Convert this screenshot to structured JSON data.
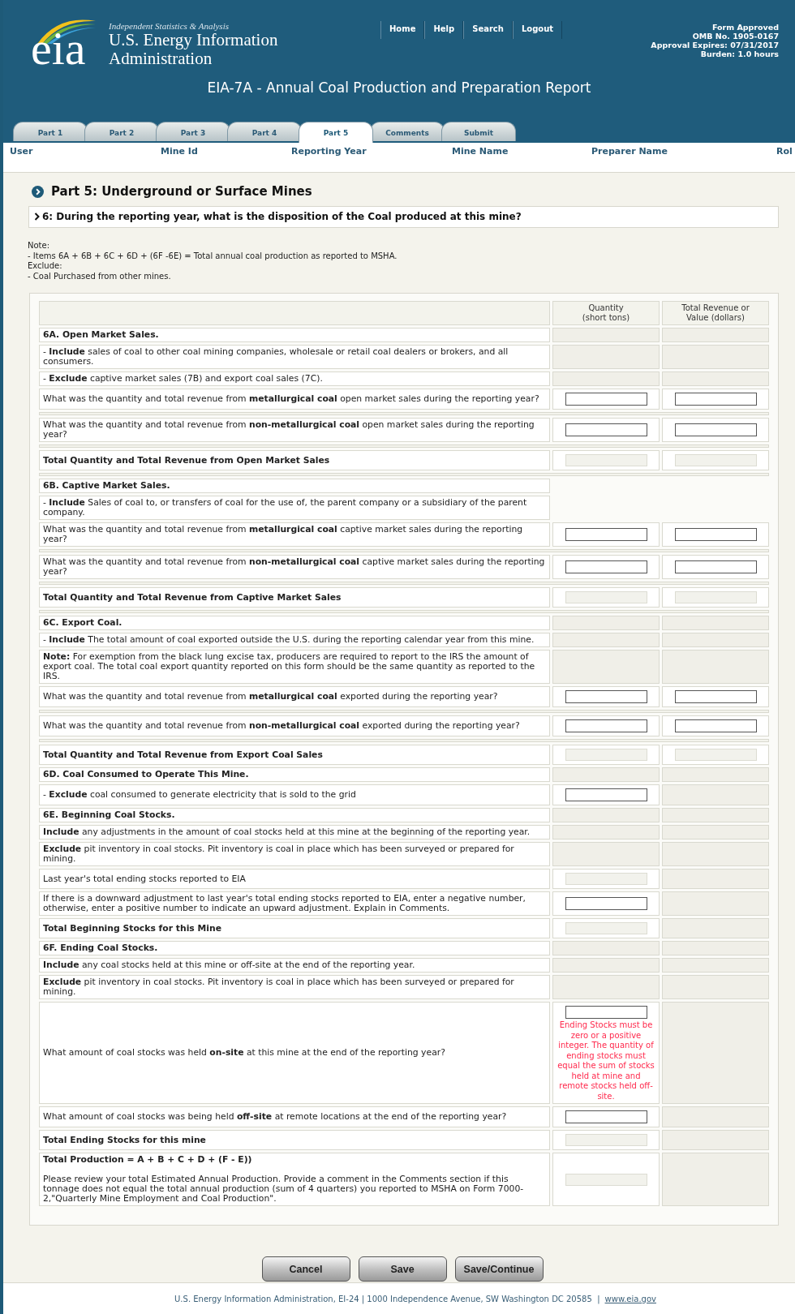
{
  "header": {
    "tagline": "Independent Statistics & Analysis",
    "agency_lines": [
      "U.S. Energy Information",
      "Administration"
    ],
    "logo_text": "eia",
    "nav": [
      "Home",
      "Help",
      "Search",
      "Logout"
    ],
    "approval": [
      "Form Approved",
      "OMB No. 1905-0167",
      "Approval Expires: 07/31/2017",
      "Burden: 1.0 hours"
    ],
    "title": "EIA-7A - Annual Coal Production and Preparation Report"
  },
  "tabs": [
    {
      "label": "Part 1",
      "selected": false
    },
    {
      "label": "Part 2",
      "selected": false
    },
    {
      "label": "Part 3",
      "selected": false
    },
    {
      "label": "Part 4",
      "selected": false
    },
    {
      "label": "Part 5",
      "selected": true
    },
    {
      "label": "Comments",
      "selected": false
    },
    {
      "label": "Submit",
      "selected": false
    }
  ],
  "info_fields": [
    "User",
    "Mine Id",
    "Reporting Year",
    "Mine Name",
    "Preparer Name",
    "Rol"
  ],
  "part_heading": "Part 5: Underground or Surface Mines",
  "question": "6: During the reporting year, what is the disposition of the Coal produced at this mine?",
  "note_lines": [
    "Note:",
    "- Items 6A + 6B + 6C + 6D + (6F -6E) = Total annual coal production as reported to MSHA.",
    "Exclude:",
    "- Coal Purchased from other mines."
  ],
  "columns": [
    {
      "lines": [
        "Quantity",
        "(short tons)"
      ]
    },
    {
      "lines": [
        "Total Revenue or",
        "Value (dollars)"
      ]
    }
  ],
  "rows": [
    {
      "kind": "heading",
      "label": "6A. Open Market Sales.",
      "cells": [
        {
          "kind": "blank"
        },
        {
          "kind": "blank"
        }
      ]
    },
    {
      "kind": "text",
      "label": "- **Include** sales of coal to other coal mining companies, wholesale or retail coal dealers or brokers, and all consumers.",
      "cells": [
        {
          "kind": "blank"
        },
        {
          "kind": "blank"
        }
      ]
    },
    {
      "kind": "text",
      "label": "- **Exclude** captive market sales (7B) and export coal sales (7C).",
      "cells": [
        {
          "kind": "blank"
        },
        {
          "kind": "blank"
        }
      ]
    },
    {
      "kind": "text",
      "label": "What was the quantity and total revenue from **metallurgical coal** open market sales during the reporting year?",
      "cells": [
        {
          "kind": "input"
        },
        {
          "kind": "input"
        }
      ]
    },
    {
      "kind": "gap"
    },
    {
      "kind": "text",
      "label": "What was the quantity and total revenue from **non-metallurgical coal** open market sales during the reporting year?",
      "cells": [
        {
          "kind": "input"
        },
        {
          "kind": "input"
        }
      ]
    },
    {
      "kind": "gap"
    },
    {
      "kind": "heading",
      "label": "Total Quantity and Total Revenue from Open Market Sales",
      "cells": [
        {
          "kind": "readonly"
        },
        {
          "kind": "readonly"
        }
      ]
    },
    {
      "kind": "gap"
    },
    {
      "kind": "heading",
      "label": "6B. Captive Market Sales.",
      "cells": [
        {
          "kind": "none"
        },
        {
          "kind": "none"
        }
      ]
    },
    {
      "kind": "text",
      "label": "- **Include** Sales of coal to, or transfers of coal for the use of, the parent company or a subsidiary of the parent company.",
      "cells": [
        {
          "kind": "none"
        },
        {
          "kind": "none"
        }
      ]
    },
    {
      "kind": "text",
      "label": "What was the quantity and total revenue from **metallurgical coal** captive market sales during the reporting year?",
      "cells": [
        {
          "kind": "input"
        },
        {
          "kind": "input"
        }
      ]
    },
    {
      "kind": "gap"
    },
    {
      "kind": "text",
      "label": "What was the quantity and total revenue from **non-metallurgical coal** captive market sales during the reporting year?",
      "cells": [
        {
          "kind": "input"
        },
        {
          "kind": "input"
        }
      ]
    },
    {
      "kind": "gap"
    },
    {
      "kind": "heading",
      "label": "Total Quantity and Total Revenue from Captive Market Sales",
      "cells": [
        {
          "kind": "readonly"
        },
        {
          "kind": "readonly"
        }
      ]
    },
    {
      "kind": "gap"
    },
    {
      "kind": "heading",
      "label": "6C. Export Coal.",
      "cells": [
        {
          "kind": "blank"
        },
        {
          "kind": "blank"
        }
      ]
    },
    {
      "kind": "text",
      "label": "- **Include**  The total amount of coal exported outside the U.S. during the reporting calendar year from this mine.",
      "cells": [
        {
          "kind": "blank"
        },
        {
          "kind": "blank"
        }
      ]
    },
    {
      "kind": "text",
      "label": "**Note:** For exemption from the black lung excise tax, producers are required to report to the IRS the amount of export coal. The total coal export quantity reported on this form should be the same quantity as reported to the IRS.",
      "cells": [
        {
          "kind": "blank"
        },
        {
          "kind": "blank"
        }
      ]
    },
    {
      "kind": "text",
      "label": "What was the quantity and total revenue from **metallurgical coal** exported during the reporting year?",
      "cells": [
        {
          "kind": "input"
        },
        {
          "kind": "input"
        }
      ]
    },
    {
      "kind": "gap"
    },
    {
      "kind": "text",
      "label": "What was the quantity and total revenue from **non-metallurgical coal** exported during the reporting year?",
      "cells": [
        {
          "kind": "input"
        },
        {
          "kind": "input"
        }
      ]
    },
    {
      "kind": "gap"
    },
    {
      "kind": "heading",
      "label": "Total Quantity and Total Revenue from Export Coal Sales",
      "cells": [
        {
          "kind": "readonly"
        },
        {
          "kind": "readonly"
        }
      ]
    },
    {
      "kind": "heading",
      "label": "6D. Coal Consumed to Operate This Mine.",
      "cells": [
        {
          "kind": "blank"
        },
        {
          "kind": "blank"
        }
      ]
    },
    {
      "kind": "text",
      "label": "- **Exclude** coal consumed to generate electricity that is sold to the grid",
      "cells": [
        {
          "kind": "input"
        },
        {
          "kind": "blank"
        }
      ]
    },
    {
      "kind": "heading",
      "label": "6E. Beginning Coal Stocks.",
      "cells": [
        {
          "kind": "blank"
        },
        {
          "kind": "blank"
        }
      ]
    },
    {
      "kind": "text",
      "label": "**Include** any adjustments in the amount of coal stocks held at this mine at the beginning of the reporting year.",
      "cells": [
        {
          "kind": "blank"
        },
        {
          "kind": "blank"
        }
      ]
    },
    {
      "kind": "text",
      "label": "**Exclude** pit inventory in coal stocks. Pit inventory is coal in place which has been surveyed or prepared for mining.",
      "cells": [
        {
          "kind": "blank"
        },
        {
          "kind": "blank"
        }
      ]
    },
    {
      "kind": "text",
      "label": "Last year's total ending stocks reported to EIA",
      "cells": [
        {
          "kind": "readonly"
        },
        {
          "kind": "blank"
        }
      ]
    },
    {
      "kind": "text",
      "label": "If there is a downward adjustment to last year's total ending stocks reported to EIA, enter a negative number, otherwise, enter a positive number to indicate an upward adjustment. Explain in Comments.",
      "cells": [
        {
          "kind": "input"
        },
        {
          "kind": "blank"
        }
      ]
    },
    {
      "kind": "heading",
      "label": "Total Beginning Stocks for this Mine",
      "cells": [
        {
          "kind": "readonly"
        },
        {
          "kind": "blank"
        }
      ]
    },
    {
      "kind": "heading",
      "label": "6F. Ending Coal Stocks.",
      "cells": [
        {
          "kind": "blank"
        },
        {
          "kind": "blank"
        }
      ]
    },
    {
      "kind": "text",
      "label": "**Include** any coal stocks held at this mine or off-site at the end of the reporting year.",
      "cells": [
        {
          "kind": "blank"
        },
        {
          "kind": "blank"
        }
      ]
    },
    {
      "kind": "text",
      "label": "**Exclude** pit inventory in coal stocks. Pit inventory is coal in place which has been surveyed or prepared for mining.",
      "cells": [
        {
          "kind": "blank"
        },
        {
          "kind": "blank"
        }
      ]
    },
    {
      "kind": "text",
      "label": "What amount of coal stocks was held **on-site** at this mine at the end of the reporting year?",
      "cells": [
        {
          "kind": "input",
          "error": "Ending Stocks must be zero or a positive integer. The quantity of ending stocks must equal the sum of stocks held at mine and remote stocks held off-site."
        },
        {
          "kind": "blank"
        }
      ]
    },
    {
      "kind": "text",
      "label": "What amount of coal stocks was being held **off-site** at remote locations at the end of the reporting year?",
      "cells": [
        {
          "kind": "input"
        },
        {
          "kind": "blank"
        }
      ]
    },
    {
      "kind": "heading",
      "label": "Total Ending Stocks for this mine",
      "cells": [
        {
          "kind": "readonly"
        },
        {
          "kind": "blank"
        }
      ]
    },
    {
      "kind": "heading",
      "label": "Total Production = A + B + C + D + (F - E))",
      "cells": [
        {
          "kind": "readonly"
        },
        {
          "kind": "blank"
        }
      ],
      "note": "Please review your total Estimated Annual Production. Provide a comment in the Comments section if this tonnage does not equal the total annual production (sum of 4 quarters) you reported to MSHA on Form 7000-2,\"Quarterly Mine Employment and Coal Production\"."
    }
  ],
  "buttons": [
    "Cancel",
    "Save",
    "Save/Continue"
  ],
  "footer": {
    "text": "U.S. Energy Information Administration, EI-24 | 1000 Independence Avenue, SW Washington DC 20585  |",
    "link": "www.eia.gov"
  }
}
